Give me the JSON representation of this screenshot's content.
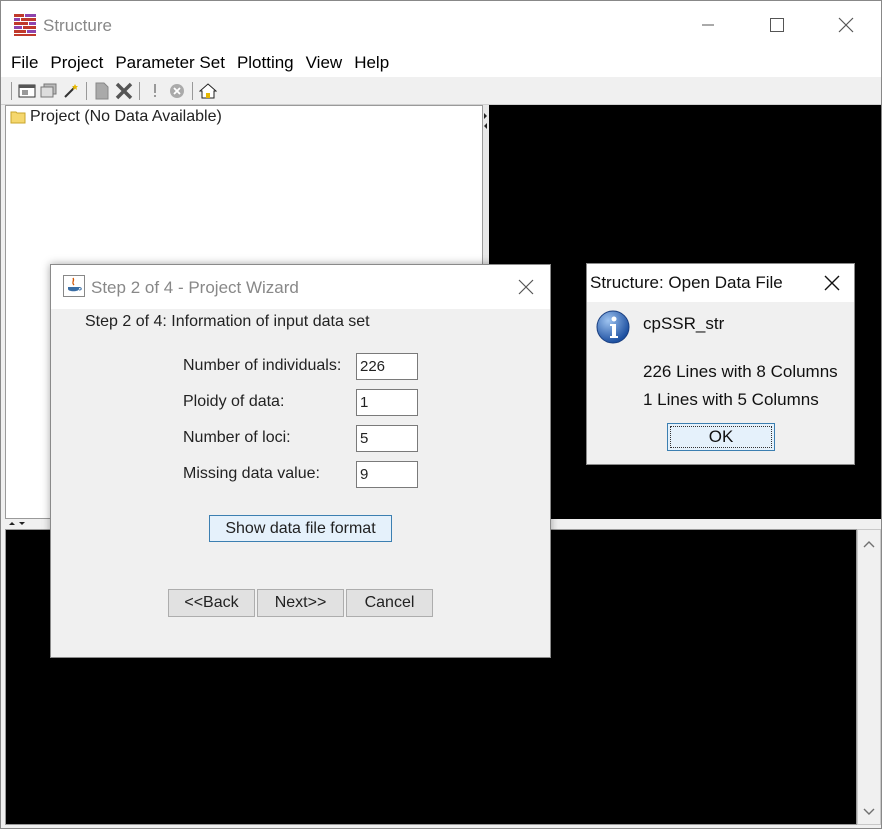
{
  "window": {
    "title": "Structure",
    "minimize_glyph": "—",
    "maximize_glyph": "☐",
    "close_glyph": "✕"
  },
  "menu": [
    "File",
    "Project",
    "Parameter Set",
    "Plotting",
    "View",
    "Help"
  ],
  "toolbar": {
    "icons": [
      "new-project-icon",
      "open-project-icon",
      "wand-icon",
      "document-icon",
      "delete-icon",
      "info-icon",
      "stop-icon",
      "home-icon"
    ]
  },
  "tree": {
    "root_label": "Project (No Data Available)"
  },
  "wizard": {
    "title": "Step 2 of 4 - Project Wizard",
    "heading": "Step 2 of 4: Information of input data set",
    "fields": [
      {
        "label": "Number of individuals:",
        "value": "226"
      },
      {
        "label": "Ploidy of data:",
        "value": "1"
      },
      {
        "label": "Number of loci:",
        "value": "5"
      },
      {
        "label": "Missing data value:",
        "value": "9"
      }
    ],
    "format_button": "Show data file format",
    "back_button": "<<Back",
    "next_button": "Next>>",
    "cancel_button": "Cancel"
  },
  "message_dialog": {
    "title": "Structure: Open Data File",
    "filename": "cpSSR_str",
    "lines": [
      "226 Lines with 8 Columns",
      "1 Lines with 5 Columns"
    ],
    "ok_button": "OK"
  },
  "colors": {
    "display_bg": "#000000",
    "dialog_bg": "#f0f0f0",
    "focused_button_bg": "#e5f1fb",
    "focused_button_border": "#3c7fb1"
  }
}
